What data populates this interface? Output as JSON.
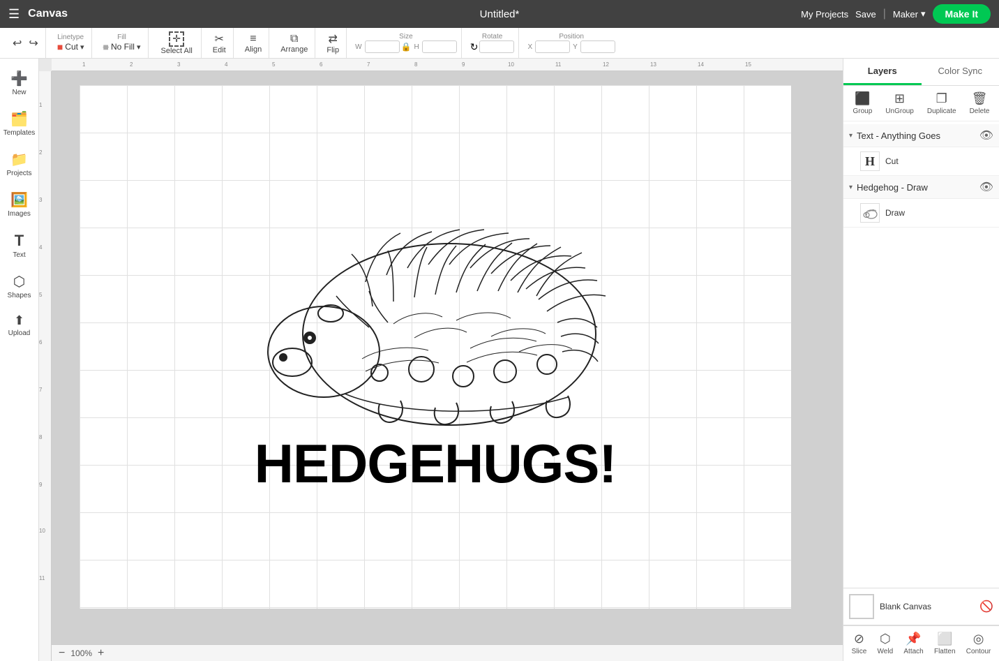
{
  "topbar": {
    "menu_icon": "☰",
    "app_name": "Canvas",
    "title": "Untitled*",
    "my_projects": "My Projects",
    "save": "Save",
    "maker": "Maker",
    "make_it": "Make It"
  },
  "toolbar": {
    "undo_label": "↩",
    "redo_label": "↪",
    "linetype_label": "Linetype",
    "linetype_val": "Cut",
    "fill_label": "Fill",
    "fill_val": "No Fill",
    "select_all": "Select All",
    "edit": "Edit",
    "align": "Align",
    "arrange": "Arrange",
    "flip": "Flip",
    "size_label": "Size",
    "w_label": "W",
    "h_label": "H",
    "rotate_label": "Rotate",
    "position_label": "Position",
    "x_label": "X",
    "y_label": "Y"
  },
  "sidebar": {
    "items": [
      {
        "icon": "➕",
        "label": "New"
      },
      {
        "icon": "🗂️",
        "label": "Templates"
      },
      {
        "icon": "📁",
        "label": "Projects"
      },
      {
        "icon": "🖼️",
        "label": "Images"
      },
      {
        "icon": "T",
        "label": "Text"
      },
      {
        "icon": "⬡",
        "label": "Shapes"
      },
      {
        "icon": "⬆",
        "label": "Upload"
      }
    ]
  },
  "canvas": {
    "zoom": "100%",
    "text": "HEDGEHUGS!"
  },
  "right_panel": {
    "tabs": [
      "Layers",
      "Color Sync"
    ],
    "active_tab": "Layers",
    "tools": {
      "group": "Group",
      "ungroup": "UnGroup",
      "duplicate": "Duplicate",
      "delete": "Delete"
    },
    "layers": [
      {
        "type": "group",
        "name": "Text - Anything Goes",
        "expanded": true,
        "children": [
          {
            "label": "H",
            "badge": "Cut"
          }
        ]
      },
      {
        "type": "group",
        "name": "Hedgehog - Draw",
        "expanded": true,
        "children": [
          {
            "label": "🦔",
            "badge": "Draw"
          }
        ]
      }
    ],
    "blank_canvas": "Blank Canvas",
    "bottom_tools": [
      "Slice",
      "Weld",
      "Attach",
      "Flatten",
      "Contour"
    ]
  },
  "ruler": {
    "h_marks": [
      "1",
      "2",
      "3",
      "4",
      "5",
      "6",
      "7",
      "8",
      "9",
      "10",
      "11",
      "12",
      "13",
      "14",
      "15"
    ],
    "v_marks": [
      "1",
      "2",
      "3",
      "4",
      "5",
      "6",
      "7",
      "8",
      "9",
      "10",
      "11"
    ]
  }
}
